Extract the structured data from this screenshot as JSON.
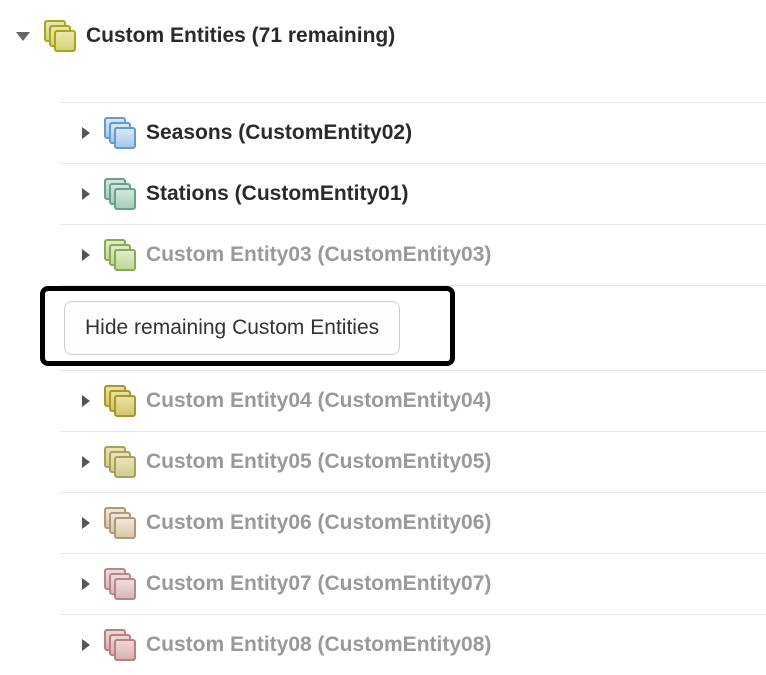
{
  "root": {
    "label": "Custom Entities (71 remaining)",
    "icon": "olive"
  },
  "hideButtonLabel": "Hide remaining Custom Entities",
  "items": [
    {
      "label": "Seasons (CustomEntity02)",
      "icon": "blue",
      "faded": false
    },
    {
      "label": "Stations (CustomEntity01)",
      "icon": "teal",
      "faded": false
    },
    {
      "label": "Custom Entity03 (CustomEntity03)",
      "icon": "green",
      "faded": true
    },
    {
      "label": "Custom Entity04 (CustomEntity04)",
      "icon": "oliveDark",
      "faded": true
    },
    {
      "label": "Custom Entity05 (CustomEntity05)",
      "icon": "olive2",
      "faded": true
    },
    {
      "label": "Custom Entity06 (CustomEntity06)",
      "icon": "tan",
      "faded": true
    },
    {
      "label": "Custom Entity07 (CustomEntity07)",
      "icon": "mauve",
      "faded": true
    },
    {
      "label": "Custom Entity08 (CustomEntity08)",
      "icon": "mauve2",
      "faded": true
    }
  ]
}
